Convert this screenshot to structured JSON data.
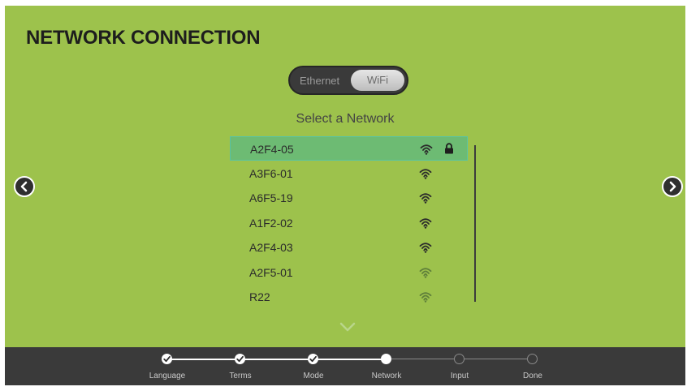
{
  "header": {
    "title": "NETWORK CONNECTION"
  },
  "connection_toggle": {
    "ethernet_label": "Ethernet",
    "wifi_label": "WiFi",
    "selected": "WiFi"
  },
  "network_list": {
    "label": "Select a Network",
    "items": [
      {
        "name": "A2F4-05",
        "signal": "strong",
        "locked": true,
        "selected": true
      },
      {
        "name": "A3F6-01",
        "signal": "strong",
        "locked": false,
        "selected": false
      },
      {
        "name": "A6F5-19",
        "signal": "strong",
        "locked": false,
        "selected": false
      },
      {
        "name": "A1F2-02",
        "signal": "strong",
        "locked": false,
        "selected": false
      },
      {
        "name": "A2F4-03",
        "signal": "strong",
        "locked": false,
        "selected": false
      },
      {
        "name": "A2F5-01",
        "signal": "weak",
        "locked": false,
        "selected": false
      },
      {
        "name": "R22",
        "signal": "weak",
        "locked": false,
        "selected": false
      }
    ],
    "icons": {
      "signal": "wifi-signal-icon",
      "lock": "lock-icon",
      "more": "chevron-down-icon"
    }
  },
  "navigation": {
    "previous_icon": "chevron-left-icon",
    "next_icon": "chevron-right-icon"
  },
  "steps": [
    {
      "label": "Language",
      "status": "done"
    },
    {
      "label": "Terms",
      "status": "done"
    },
    {
      "label": "Mode",
      "status": "done"
    },
    {
      "label": "Network",
      "status": "current"
    },
    {
      "label": "Input",
      "status": "todo"
    },
    {
      "label": "Done",
      "status": "todo"
    }
  ],
  "colors": {
    "background": "#9dc24c",
    "selected_row": "#6dbb73",
    "footer": "#3a3a3a",
    "strong_signal": "#2b2b2b",
    "weak_signal": "#5f7f3a"
  }
}
